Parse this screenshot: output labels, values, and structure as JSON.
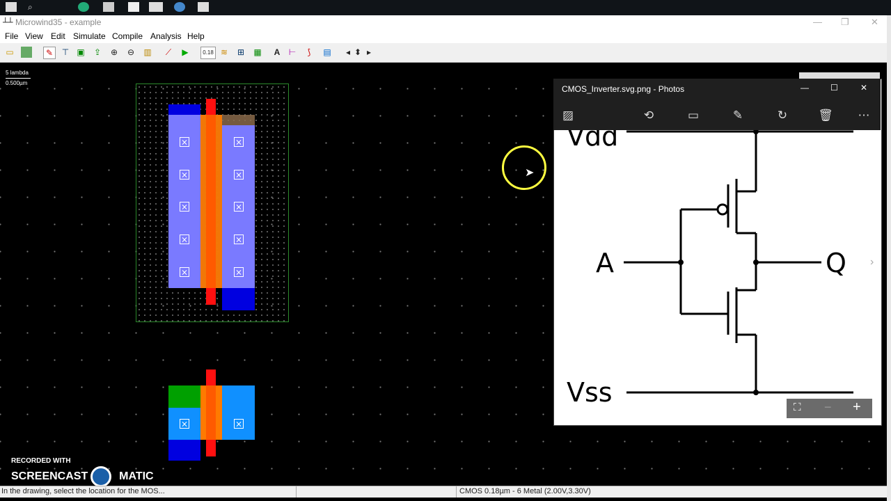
{
  "window": {
    "title": "Microwind35 - example",
    "app_glyph": "┴┴"
  },
  "menu": {
    "items": [
      "File",
      "View",
      "Edit",
      "Simulate",
      "Compile",
      "Analysis",
      "Help"
    ]
  },
  "toolbar": {
    "items": [
      "open-icon",
      "save-icon",
      "pen-icon",
      "mos-icon",
      "box-icon",
      "cut-icon",
      "zoom-in-icon",
      "zoom-out-icon",
      "fit-icon",
      "timing-icon",
      "run-icon",
      "process-icon",
      "layers-icon",
      "cross-section-icon",
      "chip-icon",
      "text-icon",
      "metal-icon",
      "curve-icon",
      "palette-icon",
      "arrow-left-icon",
      "arrow-updown-icon",
      "arrow-right-icon"
    ],
    "process_label": "0.18"
  },
  "scale": {
    "lambda": "5 lambda",
    "um": "0.500µm"
  },
  "photos": {
    "title": "CMOS_Inverter.svg.png - Photos",
    "schematic": {
      "vdd": "Vdd",
      "vss": "Vss",
      "input": "A",
      "output": "Q"
    },
    "zoom_minus": "−",
    "zoom_plus": "+"
  },
  "status": {
    "message": "In the drawing, select the location for the MOS...",
    "process": "CMOS 0.18µm - 6 Metal (2.00V,3.30V)"
  },
  "watermark": {
    "line1": "RECORDED WITH",
    "line2a": "SCREENCAST",
    "line2b": "MATIC"
  },
  "colors": {
    "ndiff": "#00c",
    "pdiff": "#8080ff",
    "poly": "#f00",
    "nwell": "#00a000",
    "cursor_ring": "#ffff40"
  }
}
